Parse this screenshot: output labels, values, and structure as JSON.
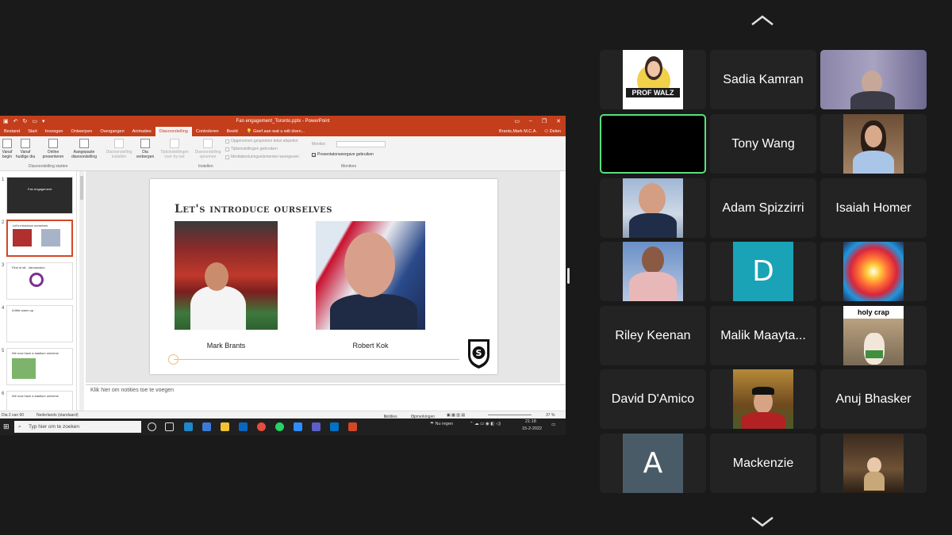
{
  "powerpoint": {
    "doc_title": "Fan engagement_Toronto.pptx - PowerPoint",
    "tabs": [
      "Bestand",
      "Start",
      "Invoegen",
      "Ontwerpen",
      "Overgangen",
      "Animaties",
      "Diavoorstelling",
      "Controleren",
      "Beeld"
    ],
    "active_tab": "Diavoorstelling",
    "tell_me": "Geef aan wat u wilt doen...",
    "user": "Brants,Mark M.C.A.",
    "share_label": "Delen",
    "ribbon": {
      "from_start": "Vanaf begin",
      "from_current": "Vanaf huidige dia",
      "online_present": "Online presenteren",
      "custom_show": "Aangepaste diavoorstelling",
      "group_start": "Diavoorstelling starten",
      "setup_show": "Diavoorstelling instellen",
      "hide_slide": "Dia verbergen",
      "rehearse": "Tijdsinstellingen voor try-out",
      "record": "Diavoorstelling opnemen",
      "chk_narration": "Opgenomen gesproken tekst afspelen",
      "chk_timings": "Tijdsinstellingen gebruiken",
      "chk_media": "Mediabesturingselementen weergeven",
      "group_setup": "Instellen",
      "monitor_label": "Monitor:",
      "chk_presenter": "Presentatorweergave gebruiken",
      "group_monitors": "Monitors"
    },
    "thumbnails": [
      {
        "num": "1",
        "title": "Fan engagement"
      },
      {
        "num": "2",
        "title": "Let's introduce ourselves"
      },
      {
        "num": "3",
        "title": "First of all - introduction"
      },
      {
        "num": "4",
        "title": "A little warm up"
      },
      {
        "num": "5",
        "title": "We now have a stadium universe"
      },
      {
        "num": "6",
        "title": "We now have a stadium universe"
      }
    ],
    "slide": {
      "title": "Let's introduce ourselves",
      "person1": "Mark Brants",
      "person2": "Robert Kok",
      "logo_letter": "S"
    },
    "notes_placeholder": "Klik hier om notities toe te voegen",
    "status": {
      "slide_of": "Dia 2 van 60",
      "language": "Nederlands (standaard)",
      "notes": "Notities",
      "comments": "Opmerkingen",
      "zoom": "37 %"
    },
    "taskbar": {
      "search_placeholder": "Typ hier om te zoeken",
      "weather": "Nu regen",
      "time": "21:18",
      "date": "15-2-2022"
    }
  },
  "gallery": {
    "tiles": [
      {
        "label": "Prof Walz",
        "kind": "image",
        "image_text": "PROF WALZ"
      },
      {
        "label": "Sadia Kamran",
        "kind": "name"
      },
      {
        "label": "",
        "kind": "video"
      },
      {
        "label": "",
        "kind": "active-black"
      },
      {
        "label": "Tony Wang",
        "kind": "name"
      },
      {
        "label": "",
        "kind": "video"
      },
      {
        "label": "",
        "kind": "video"
      },
      {
        "label": "Adam Spizzirri",
        "kind": "name"
      },
      {
        "label": "Isaiah Homer",
        "kind": "name"
      },
      {
        "label": "",
        "kind": "video"
      },
      {
        "label": "D",
        "kind": "letter",
        "color": "#1aa3b6"
      },
      {
        "label": "",
        "kind": "image"
      },
      {
        "label": "Riley Keenan",
        "kind": "name"
      },
      {
        "label": "Malik Maayta...",
        "kind": "name"
      },
      {
        "label": "holy crap",
        "kind": "image",
        "image_text": "holy crap"
      },
      {
        "label": "David D'Amico",
        "kind": "name"
      },
      {
        "label": "",
        "kind": "video"
      },
      {
        "label": "Anuj Bhasker",
        "kind": "name"
      },
      {
        "label": "A",
        "kind": "letter",
        "color": "#4a5b68"
      },
      {
        "label": "Mackenzie",
        "kind": "name"
      },
      {
        "label": "",
        "kind": "image"
      }
    ]
  },
  "colors": {
    "ppt_accent": "#c43e1c",
    "active_speaker": "#5ae07b",
    "zoom_bg": "#1a1a1a",
    "tile_bg": "#232323"
  }
}
